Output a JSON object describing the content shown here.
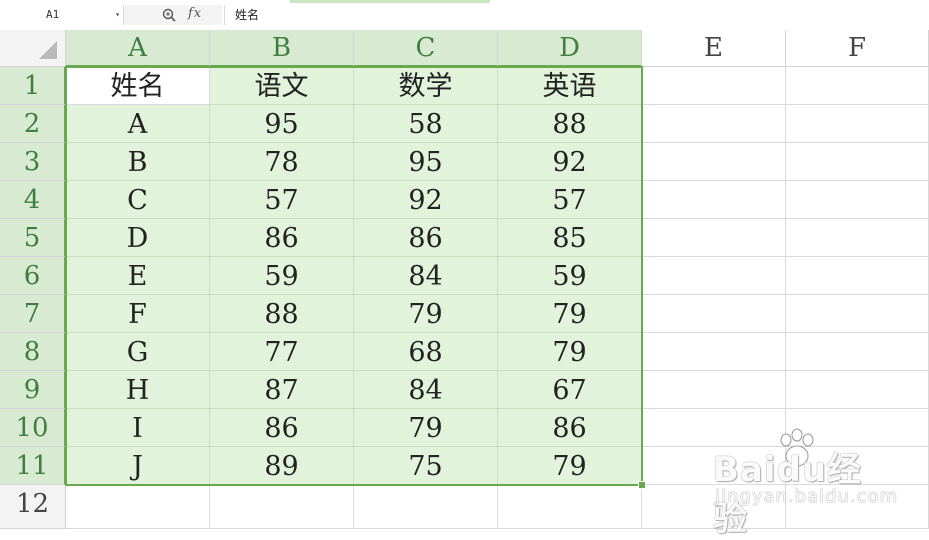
{
  "formula_bar": {
    "name_box": "A1",
    "fx_label": "fx",
    "formula_value": "姓名"
  },
  "columns": [
    "A",
    "B",
    "C",
    "D",
    "E",
    "F"
  ],
  "rows": [
    "1",
    "2",
    "3",
    "4",
    "5",
    "6",
    "7",
    "8",
    "9",
    "10",
    "11",
    "12"
  ],
  "sheet": {
    "headers": [
      "姓名",
      "语文",
      "数学",
      "英语"
    ],
    "records": [
      [
        "A",
        "95",
        "58",
        "88"
      ],
      [
        "B",
        "78",
        "95",
        "92"
      ],
      [
        "C",
        "57",
        "92",
        "57"
      ],
      [
        "D",
        "86",
        "86",
        "85"
      ],
      [
        "E",
        "59",
        "84",
        "59"
      ],
      [
        "F",
        "88",
        "79",
        "79"
      ],
      [
        "G",
        "77",
        "68",
        "79"
      ],
      [
        "H",
        "87",
        "84",
        "67"
      ],
      [
        "I",
        "86",
        "79",
        "86"
      ],
      [
        "J",
        "89",
        "75",
        "79"
      ]
    ]
  },
  "selection": {
    "range": "A1:D11",
    "active_cell": "A1"
  },
  "watermark": {
    "main": "Baidu经验",
    "sub": "jingyan.baidu.com"
  },
  "colors": {
    "selection_fill": "#e2f3dc",
    "selection_border": "#6aa84f",
    "header_selected": "#d9ead3",
    "header_text_selected": "#3f7f3f"
  },
  "icons": [
    "zoom-icon",
    "fx-icon",
    "dropdown-caret-icon",
    "select-all-triangle-icon"
  ]
}
